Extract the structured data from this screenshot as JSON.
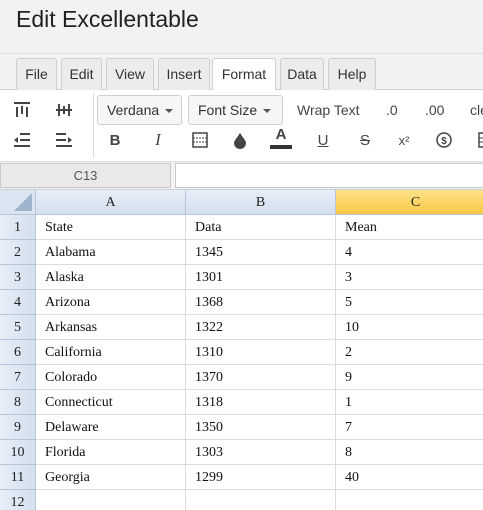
{
  "app": {
    "title": "Edit Excellentable"
  },
  "menu": {
    "tabs": [
      {
        "label": "File"
      },
      {
        "label": "Edit"
      },
      {
        "label": "View"
      },
      {
        "label": "Insert"
      },
      {
        "label": "Format"
      },
      {
        "label": "Data"
      },
      {
        "label": "Help"
      }
    ],
    "active_tab": "Format"
  },
  "toolbar": {
    "font_family": "Verdana",
    "font_size": "Font Size",
    "wrap_text": "Wrap Text",
    "decimal_decrease": ".0",
    "decimal_increase": ".00",
    "clear_partial": "cle",
    "bold": "B",
    "italic": "I",
    "underline": "U",
    "strikethrough": "S",
    "font_color_letter": "A",
    "superscript": "x²",
    "currency": "$",
    "font_color_bar": "#333333",
    "icons": [
      "align-top-icon",
      "align-middle-icon",
      "indent-decrease-icon",
      "indent-increase-icon",
      "borders-icon",
      "fill-color-icon",
      "currency-icon",
      "more-icon"
    ]
  },
  "formula_bar": {
    "cell_ref": "C13",
    "value": ""
  },
  "sheet": {
    "columns": [
      "A",
      "B",
      "C"
    ],
    "selected_column": "C",
    "rows": [
      {
        "num": "1",
        "cells": [
          "State",
          "Data",
          "Mean"
        ]
      },
      {
        "num": "2",
        "cells": [
          "Alabama",
          "1345",
          "4"
        ]
      },
      {
        "num": "3",
        "cells": [
          "Alaska",
          "1301",
          "3"
        ]
      },
      {
        "num": "4",
        "cells": [
          "Arizona",
          "1368",
          "5"
        ]
      },
      {
        "num": "5",
        "cells": [
          "Arkansas",
          "1322",
          "10"
        ]
      },
      {
        "num": "6",
        "cells": [
          "California",
          "1310",
          "2"
        ]
      },
      {
        "num": "7",
        "cells": [
          "Colorado",
          "1370",
          "9"
        ]
      },
      {
        "num": "8",
        "cells": [
          "Connecticut",
          "1318",
          "1"
        ]
      },
      {
        "num": "9",
        "cells": [
          "Delaware",
          "1350",
          "7"
        ]
      },
      {
        "num": "10",
        "cells": [
          "Florida",
          "1303",
          "8"
        ]
      },
      {
        "num": "11",
        "cells": [
          "Georgia",
          "1299",
          "40"
        ]
      },
      {
        "num": "12",
        "cells": [
          "",
          "",
          ""
        ]
      }
    ]
  },
  "colors": {
    "selected_header": "#f6c843",
    "header_blue": "#d4e0ee"
  }
}
